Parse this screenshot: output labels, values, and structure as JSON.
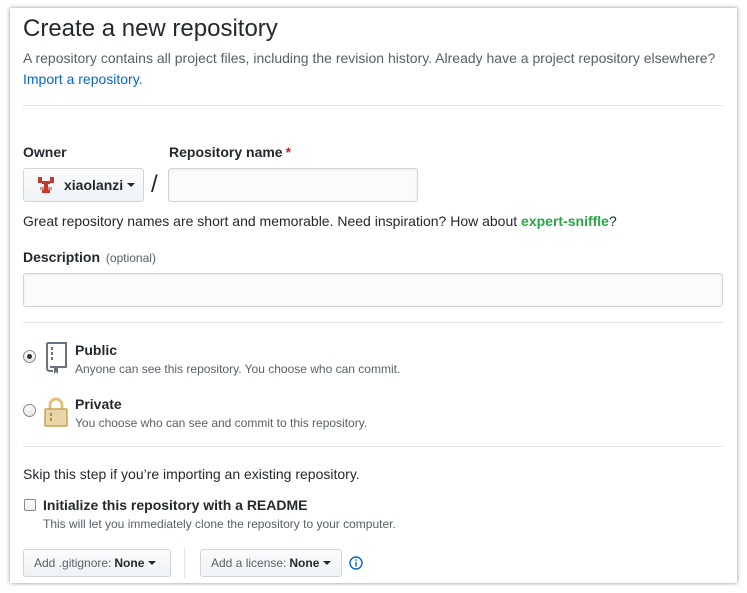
{
  "page": {
    "title": "Create a new repository",
    "subtitle": "A repository contains all project files, including the revision history. Already have a project repository elsewhere?",
    "import_link": "Import a repository."
  },
  "owner": {
    "label": "Owner",
    "value": "xiaolanzi",
    "avatar_icon": "identicon-avatar"
  },
  "separator": "/",
  "repo_name": {
    "label": "Repository name",
    "required_mark": "*",
    "value": "",
    "placeholder": ""
  },
  "hint": {
    "text": "Great repository names are short and memorable. Need inspiration? How about",
    "suggestion": "expert-sniffle",
    "end": "?"
  },
  "description": {
    "label": "Description",
    "optional": "(optional)",
    "value": "",
    "placeholder": ""
  },
  "visibility": {
    "selected": "public",
    "options": [
      {
        "id": "public",
        "title": "Public",
        "note": "Anyone can see this repository. You choose who can commit.",
        "icon": "repo-book-icon"
      },
      {
        "id": "private",
        "title": "Private",
        "note": "You choose who can see and commit to this repository.",
        "icon": "lock-icon"
      }
    ]
  },
  "init": {
    "skip_text": "Skip this step if you’re importing an existing repository.",
    "checkbox_label": "Initialize this repository with a README",
    "checkbox_note": "This will let you immediately clone the repository to your computer.",
    "checked": false
  },
  "gitignore": {
    "label": "Add .gitignore:",
    "value": "None"
  },
  "license": {
    "label": "Add a license:",
    "value": "None",
    "info_icon": "info-icon"
  },
  "colors": {
    "link": "#0366d6",
    "required": "#cb2431",
    "suggestion": "#28a745",
    "avatar": "#c0392b",
    "border": "#d1d5da"
  }
}
